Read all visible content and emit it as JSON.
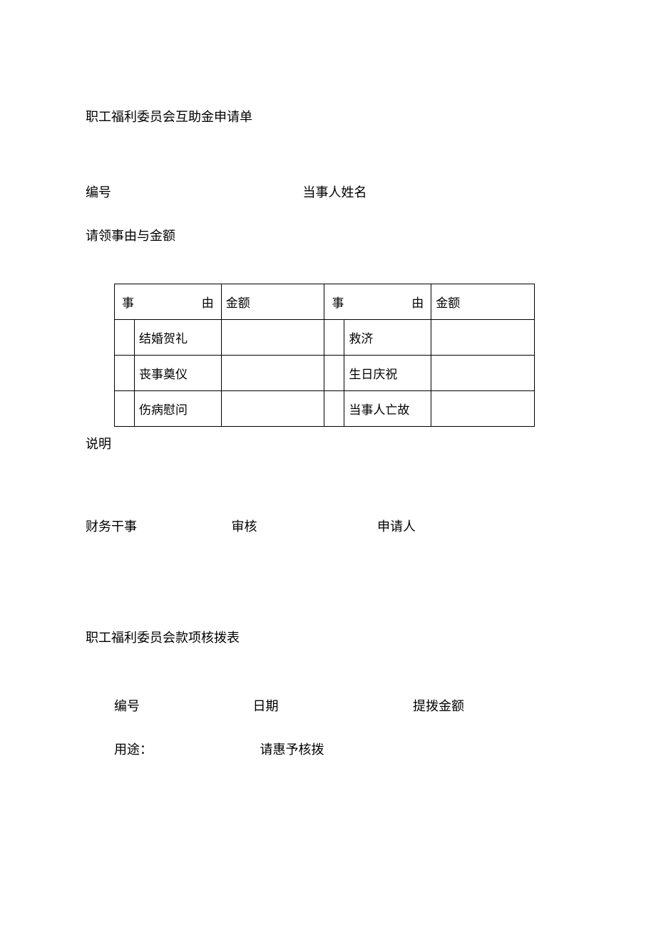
{
  "form1": {
    "title": "职工福利委员会互助金申请单",
    "number_label": "编号",
    "person_name_label": "当事人姓名",
    "reason_amount_label": "请领事由与金额",
    "table": {
      "header_reason_char1": "事",
      "header_reason_char2": "由",
      "header_amount": "金额",
      "left_items": [
        "结婚贺礼",
        "丧事奠仪",
        "伤病慰问"
      ],
      "right_items": [
        "救济",
        "生日庆祝",
        "当事人亡故"
      ]
    },
    "explain_label": "说明",
    "sign_finance": "财务干事",
    "sign_review": "审核",
    "sign_applicant": "申请人"
  },
  "form2": {
    "title": "职工福利委员会款项核拨表",
    "number_label": "编号",
    "date_label": "日期",
    "amount_label": "提拨金额",
    "purpose_label": "用途：",
    "approval_label": "请惠予核拨"
  }
}
